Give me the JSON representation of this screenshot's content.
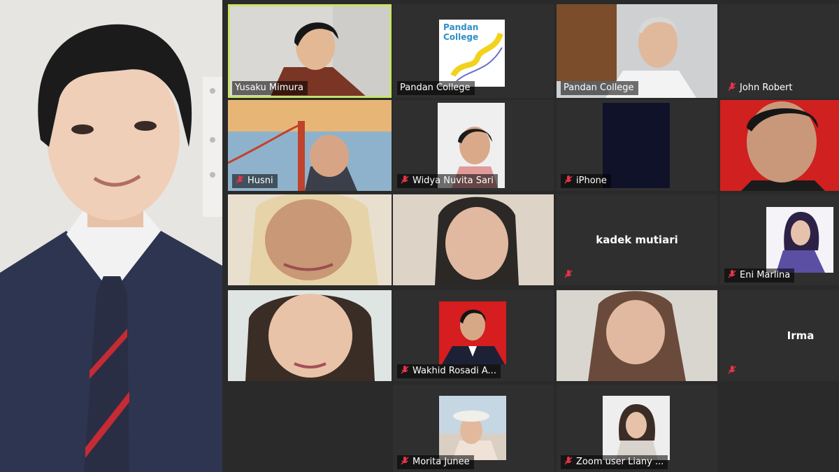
{
  "speaker": {
    "name_icon": "speaker-video"
  },
  "tiles": [
    {
      "name": "Yusaku Mimura",
      "muted": false,
      "video": true,
      "active": true
    },
    {
      "name": "Pandan College",
      "muted": false,
      "video": true,
      "logo_text": "Pandan College"
    },
    {
      "name": "Pandan College",
      "muted": false,
      "video": true
    },
    {
      "name": "John Robert",
      "muted": true,
      "video": false
    },
    {
      "name": "Husni",
      "muted": true,
      "video": true
    },
    {
      "name": "Widya Nuvita Sari",
      "muted": true,
      "video": true
    },
    {
      "name": "iPhone",
      "muted": true,
      "video": true
    },
    {
      "name": "",
      "muted": false,
      "video": true
    },
    {
      "name": "",
      "muted": false,
      "video": true
    },
    {
      "name": "",
      "muted": false,
      "video": true
    },
    {
      "name": "kadek mutiari",
      "muted": true,
      "video": false
    },
    {
      "name": "Eni Marlina",
      "muted": true,
      "video": true
    },
    {
      "name": "",
      "muted": false,
      "video": true
    },
    {
      "name": "Wakhid Rosadi A...",
      "muted": true,
      "video": true
    },
    {
      "name": "",
      "muted": false,
      "video": true
    },
    {
      "name": "Irma",
      "muted": true,
      "video": false
    },
    {
      "name": "Morita Junee",
      "muted": true,
      "video": true
    },
    {
      "name": "Zoom user Liany ...",
      "muted": true,
      "video": true
    }
  ],
  "colors": {
    "active_border": "#c7e36a",
    "muted_icon": "#e8334a",
    "tile_bg": "#2f2f2f"
  }
}
